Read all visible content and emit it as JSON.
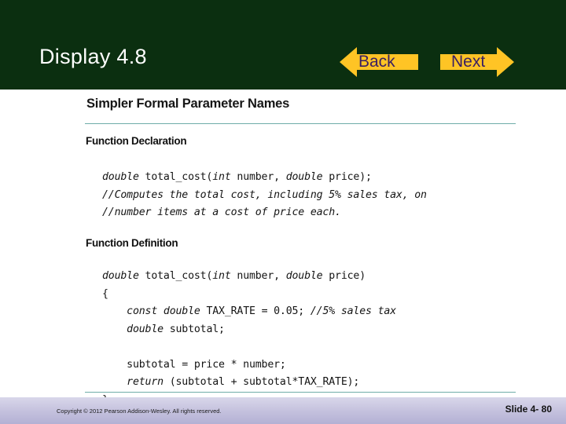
{
  "header": {
    "title": "Display 4.8",
    "background_color": "#0b2f10",
    "title_color": "#ffffff"
  },
  "nav": {
    "back": {
      "label": "Back",
      "icon": "arrow-left-icon",
      "fill_color": "#FFC425",
      "text_color": "#3a2063"
    },
    "next": {
      "label": "Next",
      "icon": "arrow-right-icon",
      "fill_color": "#FFC425",
      "text_color": "#3a2063"
    }
  },
  "content": {
    "title": "Simpler Formal Parameter Names",
    "rule_color": "#6fada8",
    "sections": [
      {
        "heading": "Function Declaration",
        "code": "double total_cost(int number, double price);\n//Computes the total cost, including 5% sales tax, on\n//number items at a cost of price each."
      },
      {
        "heading": "Function Definition",
        "code": "double total_cost(int number, double price)\n{\n    const double TAX_RATE = 0.05; //5% sales tax\n    double subtotal;\n\n    subtotal = price * number;\n    return (subtotal + subtotal*TAX_RATE);\n}"
      }
    ]
  },
  "footer": {
    "copyright": "Copyright © 2012 Pearson Addison-Wesley.  All rights reserved.",
    "slide_number": "Slide 4- 80",
    "background_color": "#c3c0dd"
  }
}
